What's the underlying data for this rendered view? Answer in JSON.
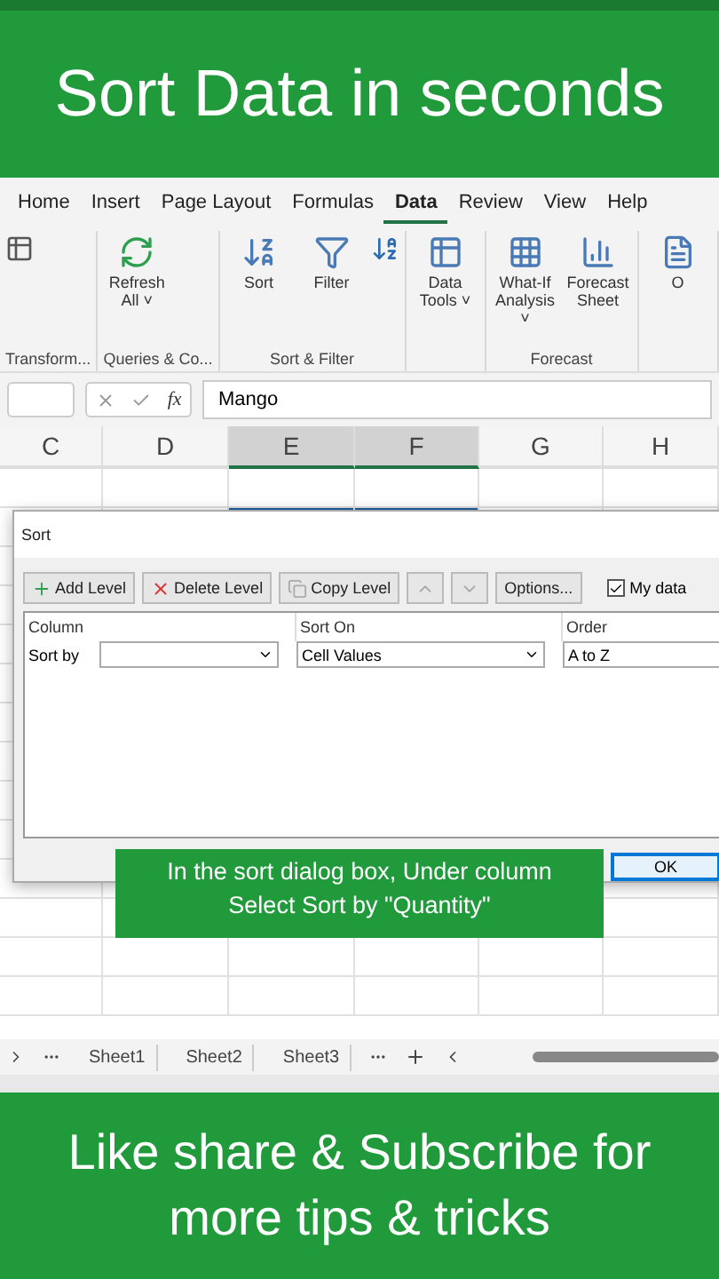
{
  "top_banner": {
    "title": "Sort Data in seconds"
  },
  "ribbon": {
    "tabs": [
      {
        "label": "Home",
        "selected": false
      },
      {
        "label": "Insert",
        "selected": false
      },
      {
        "label": "Page Layout",
        "selected": false
      },
      {
        "label": "Formulas",
        "selected": false
      },
      {
        "label": "Data",
        "selected": true
      },
      {
        "label": "Review",
        "selected": false
      },
      {
        "label": "View",
        "selected": false
      },
      {
        "label": "Help",
        "selected": false
      }
    ],
    "groups": [
      {
        "label": "Transform..."
      },
      {
        "label": "Queries & Co...",
        "buttons": [
          {
            "kind": "refresh",
            "label": "Refresh All ˅"
          }
        ]
      },
      {
        "label": "Sort & Filter",
        "buttons": [
          {
            "kind": "sort",
            "label": "Sort"
          },
          {
            "kind": "filter",
            "label": "Filter"
          }
        ]
      },
      {
        "buttons": [
          {
            "kind": "tools",
            "label": "Data Tools ˅"
          }
        ]
      },
      {
        "label": "Forecast",
        "buttons": [
          {
            "kind": "whatif",
            "label": "What-If Analysis ˅"
          },
          {
            "kind": "forecast",
            "label": "Forecast Sheet"
          }
        ]
      },
      {
        "buttons": [
          {
            "kind": "cut",
            "label": "O"
          }
        ]
      }
    ]
  },
  "formula_bar": {
    "fx": "fx",
    "value": "Mango"
  },
  "columns": [
    {
      "label": "C",
      "selected": false
    },
    {
      "label": "D",
      "selected": false
    },
    {
      "label": "E",
      "selected": true
    },
    {
      "label": "F",
      "selected": true
    },
    {
      "label": "G",
      "selected": false
    },
    {
      "label": "H",
      "selected": false
    }
  ],
  "sort_dialog": {
    "title": "Sort",
    "toolbar": [
      {
        "kind": "add",
        "label": "Add Level"
      },
      {
        "kind": "delete",
        "label": "Delete Level"
      },
      {
        "kind": "copy",
        "label": "Copy Level"
      },
      {
        "kind": "up"
      },
      {
        "kind": "down"
      },
      {
        "kind": "plain",
        "label": "Options..."
      }
    ],
    "headers_checkbox": {
      "label": "My data",
      "checked": true
    },
    "headers": [
      "Column",
      "Sort On",
      "Order"
    ],
    "row": {
      "label": "Sort by",
      "sort_on": "Cell Values",
      "order": "A to Z"
    },
    "ok": "OK"
  },
  "callout": {
    "text": "In the sort dialog box, Under column Select Sort by \"Quantity\""
  },
  "sheet_tabs": [
    {
      "label": "Sheet1",
      "selected": false
    },
    {
      "label": "Sheet2",
      "selected": false
    },
    {
      "label": "Sheet3",
      "selected": false
    }
  ],
  "bottom_banner": {
    "text": "Like share & Subscribe for more tips & tricks"
  }
}
